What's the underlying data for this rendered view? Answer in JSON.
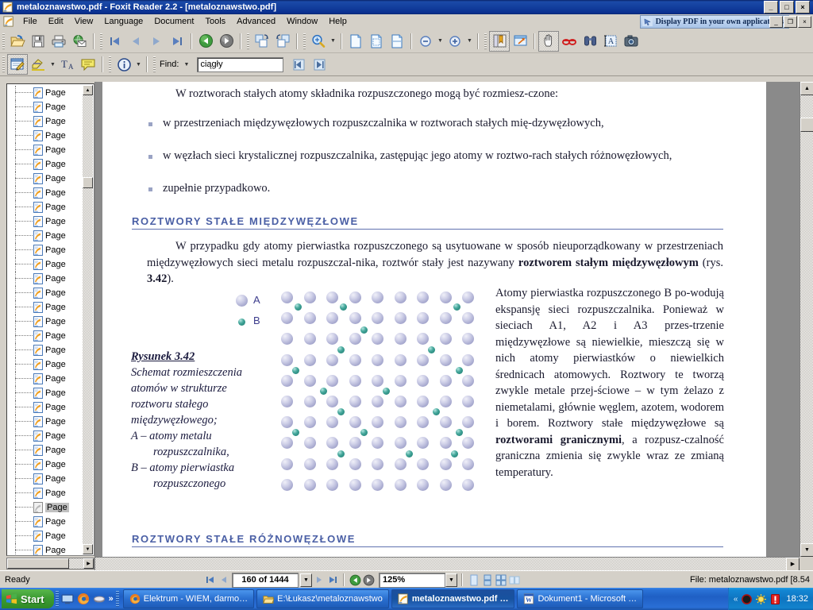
{
  "window": {
    "title": "metaloznawstwo.pdf - Foxit Reader 2.2 - [metaloznawstwo.pdf]",
    "minimize": "_",
    "maximize": "□",
    "close": "×",
    "mdi_minimize": "_",
    "mdi_restore": "❐",
    "mdi_close": "×"
  },
  "menu": {
    "items": [
      "File",
      "Edit",
      "View",
      "Language",
      "Document",
      "Tools",
      "Advanced",
      "Window",
      "Help"
    ],
    "ad_banner": "Display PDF in your own applications"
  },
  "toolbar1": {
    "buttons": [
      {
        "name": "open-file-button",
        "icon": "open-folder-icon"
      },
      {
        "name": "save-button",
        "icon": "floppy-disk-icon"
      },
      {
        "name": "print-button",
        "icon": "printer-icon"
      },
      {
        "name": "email-button",
        "icon": "globe-mail-icon"
      },
      {
        "name": "first-page-button",
        "icon": "first-page-icon"
      },
      {
        "name": "previous-page-button",
        "icon": "previous-page-icon"
      },
      {
        "name": "next-page-button",
        "icon": "next-page-icon"
      },
      {
        "name": "last-page-button",
        "icon": "last-page-icon"
      },
      {
        "name": "go-back-button",
        "icon": "green-back-arrow-icon"
      },
      {
        "name": "go-forward-button",
        "icon": "gray-forward-arrow-icon"
      },
      {
        "name": "rotate-clockwise-button",
        "icon": "rotate-cw-icon"
      },
      {
        "name": "rotate-counterclockwise-button",
        "icon": "rotate-ccw-icon"
      },
      {
        "name": "zoom-tool-button",
        "icon": "magnifier-plus-icon"
      },
      {
        "name": "actual-size-button",
        "icon": "page-actual-size-icon"
      },
      {
        "name": "fit-page-button",
        "icon": "fit-page-icon"
      },
      {
        "name": "fit-width-button",
        "icon": "fit-width-icon"
      },
      {
        "name": "zoom-out-button",
        "icon": "zoom-out-icon"
      },
      {
        "name": "zoom-in-button",
        "icon": "zoom-in-icon"
      },
      {
        "name": "show-navigation-panel-button",
        "icon": "bookmark-panel-icon"
      },
      {
        "name": "full-screen-button",
        "icon": "fullscreen-icon"
      },
      {
        "name": "hand-tool-button",
        "icon": "hand-icon"
      },
      {
        "name": "select-annotation-button",
        "icon": "red-glasses-icon"
      },
      {
        "name": "find-button",
        "icon": "binoculars-icon"
      },
      {
        "name": "select-text-button",
        "icon": "select-text-icon"
      },
      {
        "name": "snapshot-button",
        "icon": "camera-icon"
      }
    ]
  },
  "toolbar2": {
    "buttons": [
      {
        "name": "edit-notes-button",
        "icon": "notepad-pencil-icon"
      },
      {
        "name": "highlight-button",
        "icon": "highlighter-icon"
      },
      {
        "name": "typewriter-button",
        "icon": "typewriter-ta-icon"
      },
      {
        "name": "sticky-note-button",
        "icon": "sticky-note-icon"
      },
      {
        "name": "document-info-button",
        "icon": "info-circle-icon"
      }
    ],
    "find_label": "Find:",
    "find_value": "ciągły",
    "find_placeholder": "",
    "find_prev": "find-previous-icon",
    "find_next": "find-next-icon"
  },
  "sidebar": {
    "items": [
      {
        "label": "Page ",
        "selected": false
      },
      {
        "label": "Page ",
        "selected": false
      },
      {
        "label": "Page ",
        "selected": false
      },
      {
        "label": "Page ",
        "selected": false
      },
      {
        "label": "Page ",
        "selected": false
      },
      {
        "label": "Page ",
        "selected": false
      },
      {
        "label": "Page ",
        "selected": false
      },
      {
        "label": "Page ",
        "selected": false
      },
      {
        "label": "Page ",
        "selected": false
      },
      {
        "label": "Page ",
        "selected": false
      },
      {
        "label": "Page ",
        "selected": false
      },
      {
        "label": "Page ",
        "selected": false
      },
      {
        "label": "Page ",
        "selected": false
      },
      {
        "label": "Page ",
        "selected": false
      },
      {
        "label": "Page ",
        "selected": false
      },
      {
        "label": "Page ",
        "selected": false
      },
      {
        "label": "Page ",
        "selected": false
      },
      {
        "label": "Page ",
        "selected": false
      },
      {
        "label": "Page ",
        "selected": false
      },
      {
        "label": "Page ",
        "selected": false
      },
      {
        "label": "Page ",
        "selected": false
      },
      {
        "label": "Page ",
        "selected": false
      },
      {
        "label": "Page ",
        "selected": false
      },
      {
        "label": "Page ",
        "selected": false
      },
      {
        "label": "Page ",
        "selected": false
      },
      {
        "label": "Page ",
        "selected": false
      },
      {
        "label": "Page ",
        "selected": false
      },
      {
        "label": "Page ",
        "selected": false
      },
      {
        "label": "Page ",
        "selected": false
      },
      {
        "label": "Page ",
        "selected": true
      },
      {
        "label": "Page ",
        "selected": false
      },
      {
        "label": "Page ",
        "selected": false
      },
      {
        "label": "Page ",
        "selected": false
      }
    ]
  },
  "document": {
    "para1": "W roztworach stałych atomy składnika rozpuszczonego mogą być rozmiesz-czone:",
    "bullets": [
      "w przestrzeniach międzywęzłowych rozpuszczalnika w roztworach stałych mię-dzywęzłowych,",
      "w węzłach sieci krystalicznej rozpuszczalnika, zastępując jego atomy w roztwo-rach stałych różnowęzłowych,",
      "zupełnie przypadkowo."
    ],
    "heading1": "ROZTWORY STAŁE MIĘDZYWĘZŁOWE",
    "para2_before": "W przypadku gdy atomy pierwiastka rozpuszczonego są usytuowane w sposób nieuporządkowany w przestrzeniach międzywęzłowych sieci metalu rozpuszczal-nika, roztwór stały jest nazywany ",
    "para2_bold": "roztworem stałym międzywęzłowym",
    "para2_after": " (rys. ",
    "para2_bold2": "3.42",
    "para2_end": ").",
    "para3_1": "Atomy pierwiastka rozpuszczonego B po-wodują ekspansję sieci rozpuszczalnika. Ponieważ w sieciach A1, A2 i A3 przes-trzenie międzywęzłowe są niewielkie, mieszczą się w nich atomy pierwiastków o niewielkich średnicach atomowych. Roztwory te tworzą zwykle metale przej-ściowe – w tym żelazo z niemetalami, głównie węglem, azotem, wodorem i borem. Roztwory stałe międzywęzłowe są ",
    "para3_bold": "roztworami granicznymi",
    "para3_2": ", a rozpusz-czalność graniczna zmienia się zwykle wraz ze zmianą temperatury.",
    "figure": {
      "caption_title": "Rysunek 3.42",
      "caption_lines": [
        "Schemat rozmieszczenia",
        "atomów w strukturze",
        "roztworu stałego",
        "międzywęzłowego;",
        "A – atomy metalu",
        "rozpuszczalnika,",
        "B – atomy pierwiastka",
        "rozpuszczonego"
      ],
      "legend_a": "A",
      "legend_b": "B",
      "atom_a_color": "#a9abd0",
      "atom_b_color": "#17776c",
      "lattice_cols": 9,
      "lattice_rows": 10,
      "interstitials": [
        [
          0.5,
          0.45
        ],
        [
          2.5,
          0.45
        ],
        [
          7.5,
          0.45
        ],
        [
          3.4,
          1.55
        ],
        [
          2.4,
          2.5
        ],
        [
          6.4,
          2.5
        ],
        [
          0.4,
          3.5
        ],
        [
          7.6,
          3.5
        ],
        [
          1.6,
          4.5
        ],
        [
          4.4,
          4.5
        ],
        [
          2.4,
          5.5
        ],
        [
          6.6,
          5.5
        ],
        [
          0.4,
          6.5
        ],
        [
          3.4,
          6.5
        ],
        [
          7.6,
          6.5
        ],
        [
          2.4,
          7.5
        ],
        [
          5.4,
          7.5
        ],
        [
          7.4,
          7.5
        ]
      ]
    },
    "heading2": "ROZTWORY STAŁE RÓŻNOWĘZŁOWE"
  },
  "statusbar": {
    "ready": "Ready",
    "first_page": "first-page-icon",
    "prev_page": "previous-page-icon",
    "page_value": "160 of 1444",
    "next_page": "next-page-icon",
    "last_page": "last-page-icon",
    "back": "back-icon",
    "forward": "forward-icon",
    "zoom_value": "125%",
    "layout_single": "single-page-layout-icon",
    "layout_continuous": "continuous-layout-icon",
    "layout_facing": "facing-layout-icon",
    "layout_cont_facing": "continuous-facing-layout-icon",
    "file_info": "File: metaloznawstwo.pdf [8.54"
  },
  "taskbar": {
    "start": "Start",
    "quick_launch": [
      "show-desktop-icon",
      "firefox-icon",
      "windows-media-icon",
      "more-chevron-icon"
    ],
    "tasks": [
      {
        "label": "Elektrum - WIEM, darmo…",
        "icon": "firefox-icon",
        "active": false
      },
      {
        "label": "E:\\Łukasz\\metaloznawstwo",
        "icon": "folder-icon",
        "active": false
      },
      {
        "label": "metaloznawstwo.pdf …",
        "icon": "foxit-icon",
        "active": true
      },
      {
        "label": "Dokument1 - Microsoft …",
        "icon": "word-icon",
        "active": false
      }
    ],
    "tray_chevron": "«",
    "tray_icons": [
      "record-icon",
      "sun-icon",
      "warning-icon"
    ],
    "clock": "18:32"
  }
}
